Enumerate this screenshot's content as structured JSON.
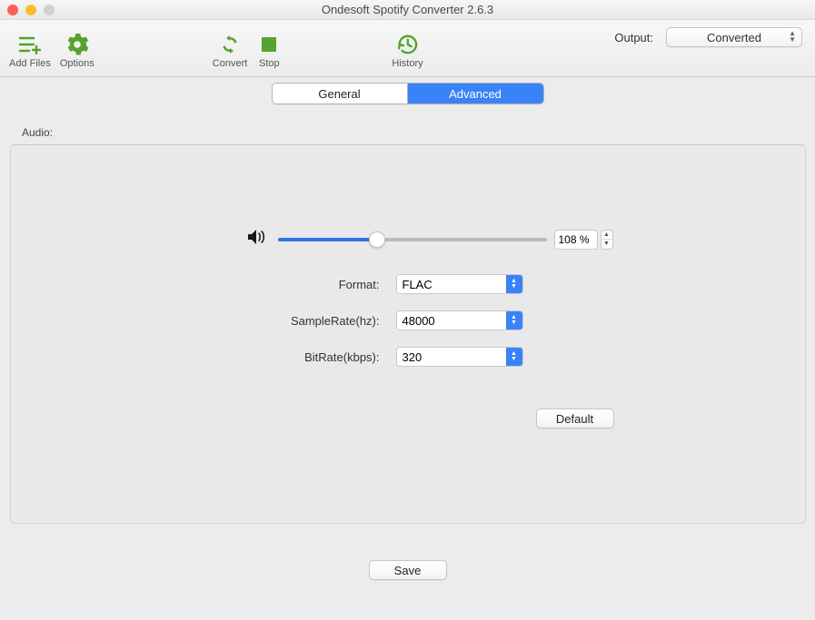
{
  "window": {
    "title": "Ondesoft Spotify Converter 2.6.3"
  },
  "toolbar": {
    "add_files": "Add Files",
    "options": "Options",
    "convert": "Convert",
    "stop": "Stop",
    "history": "History",
    "output_label": "Output:",
    "output_value": "Converted"
  },
  "tabs": {
    "general": "General",
    "advanced": "Advanced"
  },
  "section": {
    "audio": "Audio:"
  },
  "volume": {
    "value": "108 %"
  },
  "form": {
    "format_label": "Format:",
    "format_value": "FLAC",
    "samplerate_label": "SampleRate(hz):",
    "samplerate_value": "48000",
    "bitrate_label": "BitRate(kbps):",
    "bitrate_value": "320"
  },
  "buttons": {
    "default": "Default",
    "save": "Save"
  }
}
